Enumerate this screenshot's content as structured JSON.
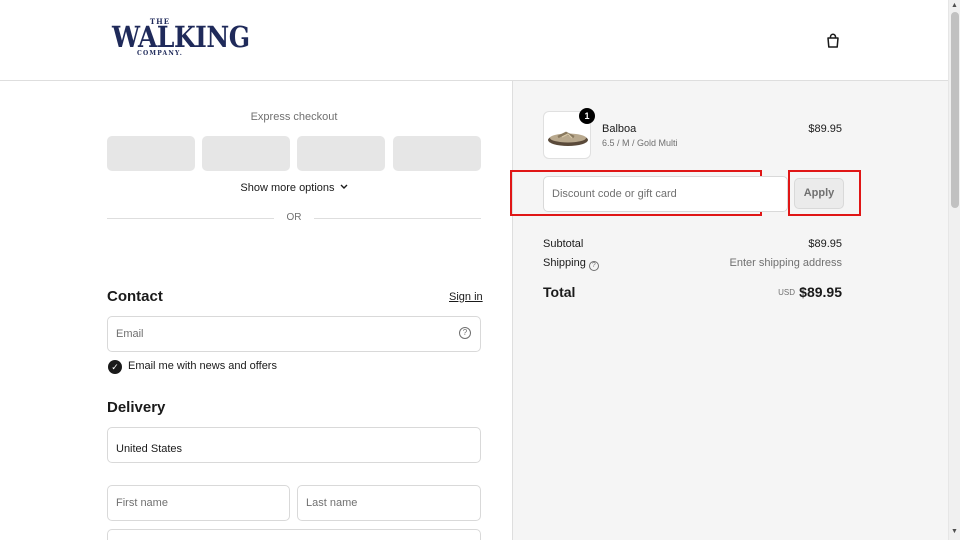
{
  "header": {
    "logo": {
      "the": "THE",
      "walking": "WALKING",
      "company": "COMPANY."
    },
    "cart_icon": "shopping-bag-icon"
  },
  "express": {
    "label": "Express checkout",
    "show_more": "Show more options",
    "or": "OR"
  },
  "contact": {
    "heading": "Contact",
    "signin": "Sign in",
    "email_placeholder": "Email",
    "newsletter_label": "Email me with news and offers",
    "newsletter_checked": true
  },
  "delivery": {
    "heading": "Delivery",
    "country": "United States",
    "first_name_placeholder": "First name",
    "last_name_placeholder": "Last name"
  },
  "summary": {
    "product": {
      "name": "Balboa",
      "variant": "6.5 / M / Gold Multi",
      "price": "$89.95",
      "quantity": "1"
    },
    "discount_placeholder": "Discount code or gift card",
    "apply_label": "Apply",
    "subtotal_label": "Subtotal",
    "subtotal_value": "$89.95",
    "shipping_label": "Shipping",
    "shipping_value": "Enter shipping address",
    "total_label": "Total",
    "currency": "USD",
    "total_value": "$89.95"
  },
  "colors": {
    "highlight": "#e01616",
    "logo": "#1f2a5a"
  }
}
